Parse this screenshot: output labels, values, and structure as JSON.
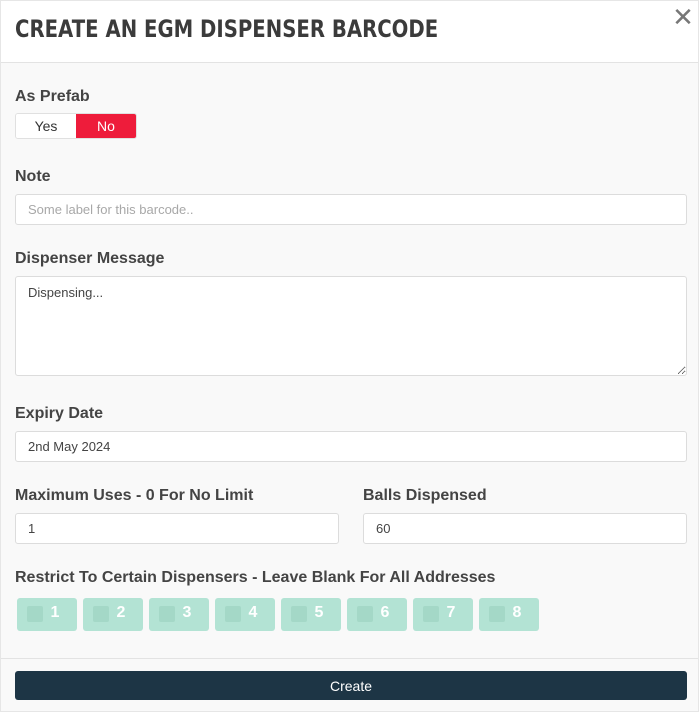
{
  "modal": {
    "title": "CREATE AN EGM DISPENSER BARCODE",
    "close_glyph": "✕"
  },
  "prefab": {
    "label": "As Prefab",
    "yes": "Yes",
    "no": "No",
    "selected": "No"
  },
  "note": {
    "label": "Note",
    "value": "",
    "placeholder": "Some label for this barcode.."
  },
  "dispenser_message": {
    "label": "Dispenser Message",
    "value": "Dispensing..."
  },
  "expiry": {
    "label": "Expiry Date",
    "value": "2nd May 2024"
  },
  "max_uses": {
    "label": "Maximum Uses - 0 For No Limit",
    "value": "1"
  },
  "balls": {
    "label": "Balls Dispensed",
    "value": "60"
  },
  "restrict": {
    "label": "Restrict To Certain Dispensers - Leave Blank For All Addresses",
    "dispensers": [
      "1",
      "2",
      "3",
      "4",
      "5",
      "6",
      "7",
      "8"
    ]
  },
  "actions": {
    "create_label": "Create"
  },
  "colors": {
    "accent_red": "#ee1c3b",
    "button_dark": "#1d3545",
    "chip_green": "#b3e3d4"
  }
}
